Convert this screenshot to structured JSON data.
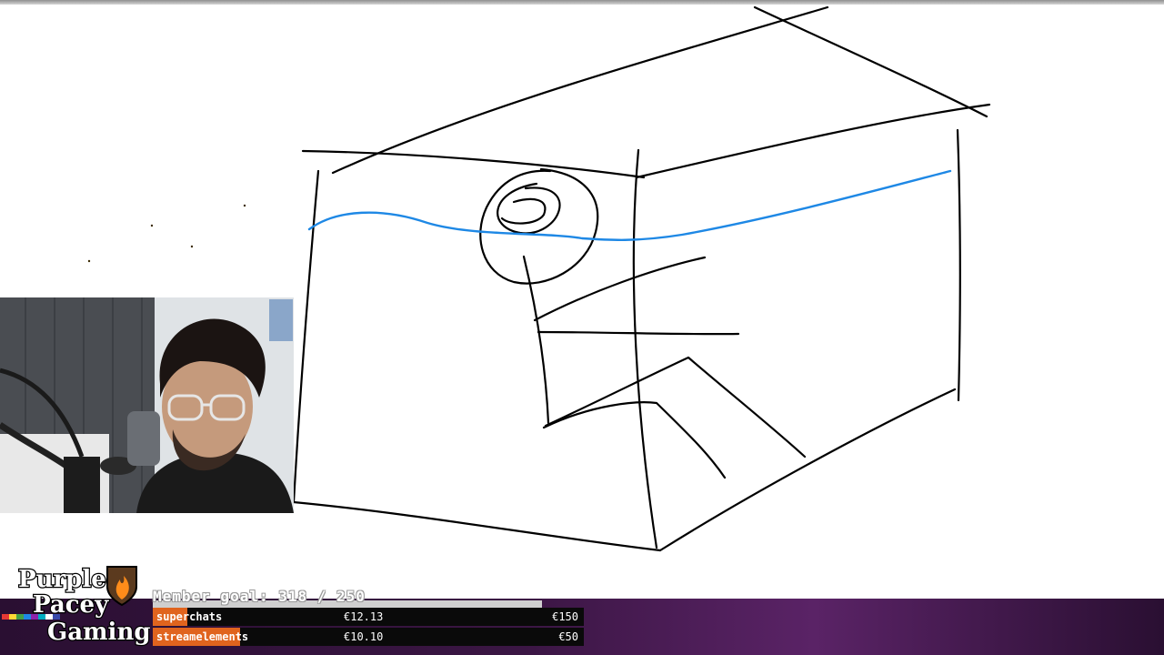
{
  "stream": {
    "member_goal": "Member goal: 318 / 250",
    "member_goal_progress": 1.0,
    "logo": {
      "line1": "Purple",
      "line2": "Pacey",
      "line3": "Gaming",
      "icon": "shield-flame-icon"
    },
    "donations": [
      {
        "name": "superchats",
        "amount": "€12.13",
        "target": "€150",
        "progress": 0.081
      },
      {
        "name": "streamelements",
        "amount": "€10.10",
        "target": "€50",
        "progress": 0.202
      }
    ]
  },
  "colors": {
    "ink": "#000000",
    "highlight": "#1e88e5",
    "bar_fill": "#e0641e",
    "strip_bg": "#3b1644"
  }
}
